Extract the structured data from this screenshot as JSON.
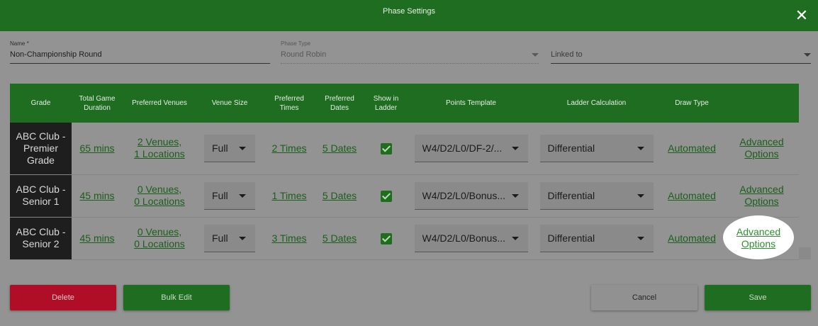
{
  "dialog": {
    "title": "Phase Settings",
    "close_icon": "close-icon"
  },
  "form": {
    "name": {
      "label": "Name *",
      "value": "Non-Championship Round"
    },
    "phase_type": {
      "label": "Phase Type",
      "value": "Round Robin"
    },
    "linked_to": {
      "placeholder": "Linked to"
    }
  },
  "table": {
    "headers": [
      "Grade",
      "Total Game Duration",
      "Preferred Venues",
      "Venue Size",
      "Preferred Times",
      "Preferred Dates",
      "Show in Ladder",
      "Points Template",
      "Ladder Calculation",
      "Draw Type",
      ""
    ],
    "rows": [
      {
        "grade": "ABC Club - Premier Grade",
        "duration": "65 mins",
        "venues": "2 Venues,",
        "locations": "1 Locations",
        "venue_size": "Full",
        "times": "2 Times",
        "dates": "5 Dates",
        "show_in_ladder": true,
        "points_template": "W4/D2/L0/DF-2/...",
        "ladder_calculation": "Differential",
        "draw_type": "Automated",
        "advanced_line1": "Advanced",
        "advanced_line2": "Options"
      },
      {
        "grade": "ABC Club - Senior 1",
        "duration": "45 mins",
        "venues": "0 Venues,",
        "locations": "0 Locations",
        "venue_size": "Full",
        "times": "1 Times",
        "dates": "5 Dates",
        "show_in_ladder": true,
        "points_template": "W4/D2/L0/Bonus...",
        "ladder_calculation": "Differential",
        "draw_type": "Automated",
        "advanced_line1": "Advanced",
        "advanced_line2": "Options"
      },
      {
        "grade": "ABC Club - Senior 2",
        "duration": "45 mins",
        "venues": "0 Venues,",
        "locations": "0 Locations",
        "venue_size": "Full",
        "times": "3 Times",
        "dates": "5 Dates",
        "show_in_ladder": true,
        "points_template": "W4/D2/L0/Bonus...",
        "ladder_calculation": "Differential",
        "draw_type": "Automated",
        "advanced_line1": "Advanced",
        "advanced_line2": "Options"
      }
    ]
  },
  "buttons": {
    "delete": "Delete",
    "bulk_edit": "Bulk Edit",
    "cancel": "Cancel",
    "save": "Save"
  },
  "colors": {
    "header_green": "#1f6d20",
    "delete_red": "#b00d27",
    "overlay_gray": "#939393"
  }
}
